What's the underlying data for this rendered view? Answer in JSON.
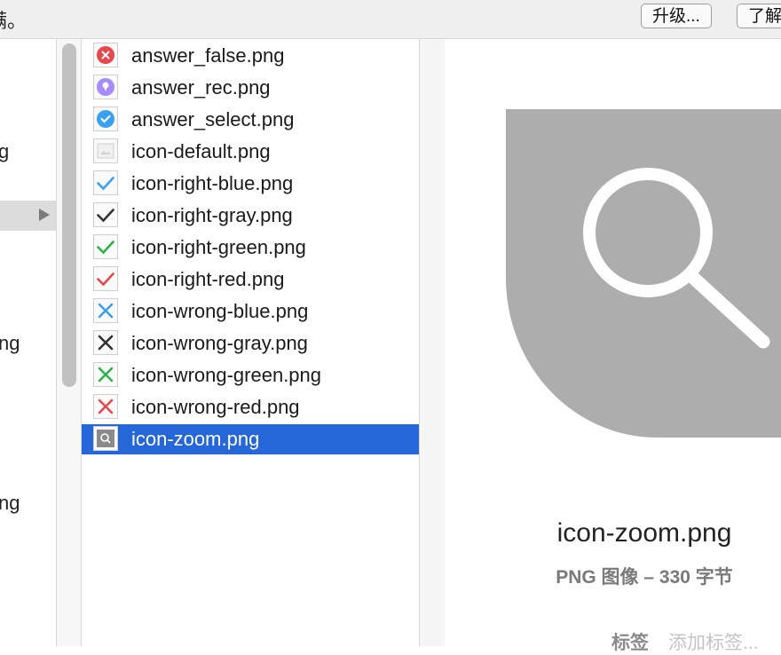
{
  "topbar": {
    "message_fragment": "满。",
    "upgrade_button": "升级...",
    "learn_button": "了解"
  },
  "sidebar_fragments": [
    "g",
    "ng",
    "ng"
  ],
  "files": [
    {
      "name": "answer_false.png",
      "icon": "answer-false-icon",
      "color": "#e5484d"
    },
    {
      "name": "answer_rec.png",
      "icon": "answer-rec-icon",
      "color": "#a78bfa"
    },
    {
      "name": "answer_select.png",
      "icon": "answer-select-icon",
      "color": "#3aa0f0"
    },
    {
      "name": "icon-default.png",
      "icon": "image-icon",
      "color": "#d0d0d0"
    },
    {
      "name": "icon-right-blue.png",
      "icon": "check-icon",
      "color": "#3aa0f0"
    },
    {
      "name": "icon-right-gray.png",
      "icon": "check-icon",
      "color": "#333333"
    },
    {
      "name": "icon-right-green.png",
      "icon": "check-icon",
      "color": "#2bb34a"
    },
    {
      "name": "icon-right-red.png",
      "icon": "check-icon",
      "color": "#e5484d"
    },
    {
      "name": "icon-wrong-blue.png",
      "icon": "cross-icon",
      "color": "#3aa0f0"
    },
    {
      "name": "icon-wrong-gray.png",
      "icon": "cross-icon",
      "color": "#333333"
    },
    {
      "name": "icon-wrong-green.png",
      "icon": "cross-icon",
      "color": "#2bb34a"
    },
    {
      "name": "icon-wrong-red.png",
      "icon": "cross-icon",
      "color": "#e5484d"
    },
    {
      "name": "icon-zoom.png",
      "icon": "zoom-icon",
      "color": "#8a8a8a",
      "selected": true
    }
  ],
  "preview": {
    "filename": "icon-zoom.png",
    "meta": "PNG 图像 – 330 字节",
    "tags_label": "标签",
    "tags_placeholder": "添加标签..."
  },
  "colors": {
    "selection": "#2566d8",
    "preview_image_bg": "#adadad"
  }
}
